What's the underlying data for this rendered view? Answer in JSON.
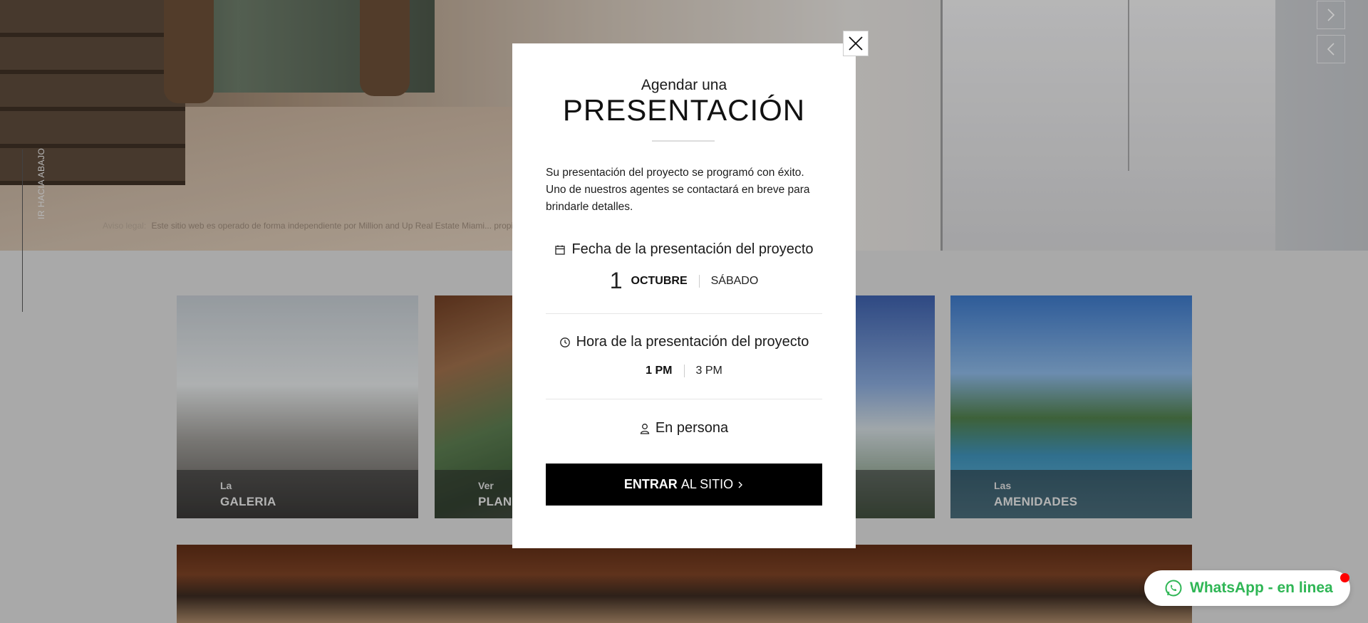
{
  "page": {
    "scroll_down_label": "IR HACIA ABAJO",
    "legal": {
      "label": "Aviso legal:",
      "text": "Este sitio web es operado de forma independiente por Million and Up Real Estate Miami... propietarios o el edificio."
    },
    "cards": [
      {
        "small": "La",
        "big": "GALERIA"
      },
      {
        "small": "Ver",
        "big": "PLANOS"
      },
      {
        "small": "",
        "big": ""
      },
      {
        "small": "Las",
        "big": "AMENIDADES"
      }
    ]
  },
  "modal": {
    "pre_title": "Agendar una",
    "title": "PRESENTACIÓN",
    "message": "Su presentación del proyecto se programó con éxito. Uno de nuestros agentes se contactará en breve para brindarle detalles.",
    "date_section": {
      "label": "Fecha de la presentación del proyecto",
      "day": "1",
      "month": "OCTUBRE",
      "weekday": "SÁBADO"
    },
    "time_section": {
      "label": "Hora de la presentación del proyecto",
      "selected_time": "1 PM",
      "other_time": "3 PM"
    },
    "mode": "En persona",
    "enter_button": {
      "bold": "ENTRAR",
      "rest": "AL SITIO"
    }
  },
  "whatsapp": {
    "label": "WhatsApp - en linea"
  },
  "colors": {
    "accent_black": "#000000",
    "whatsapp_green": "#2fb655",
    "online_dot": "#ff0000"
  }
}
